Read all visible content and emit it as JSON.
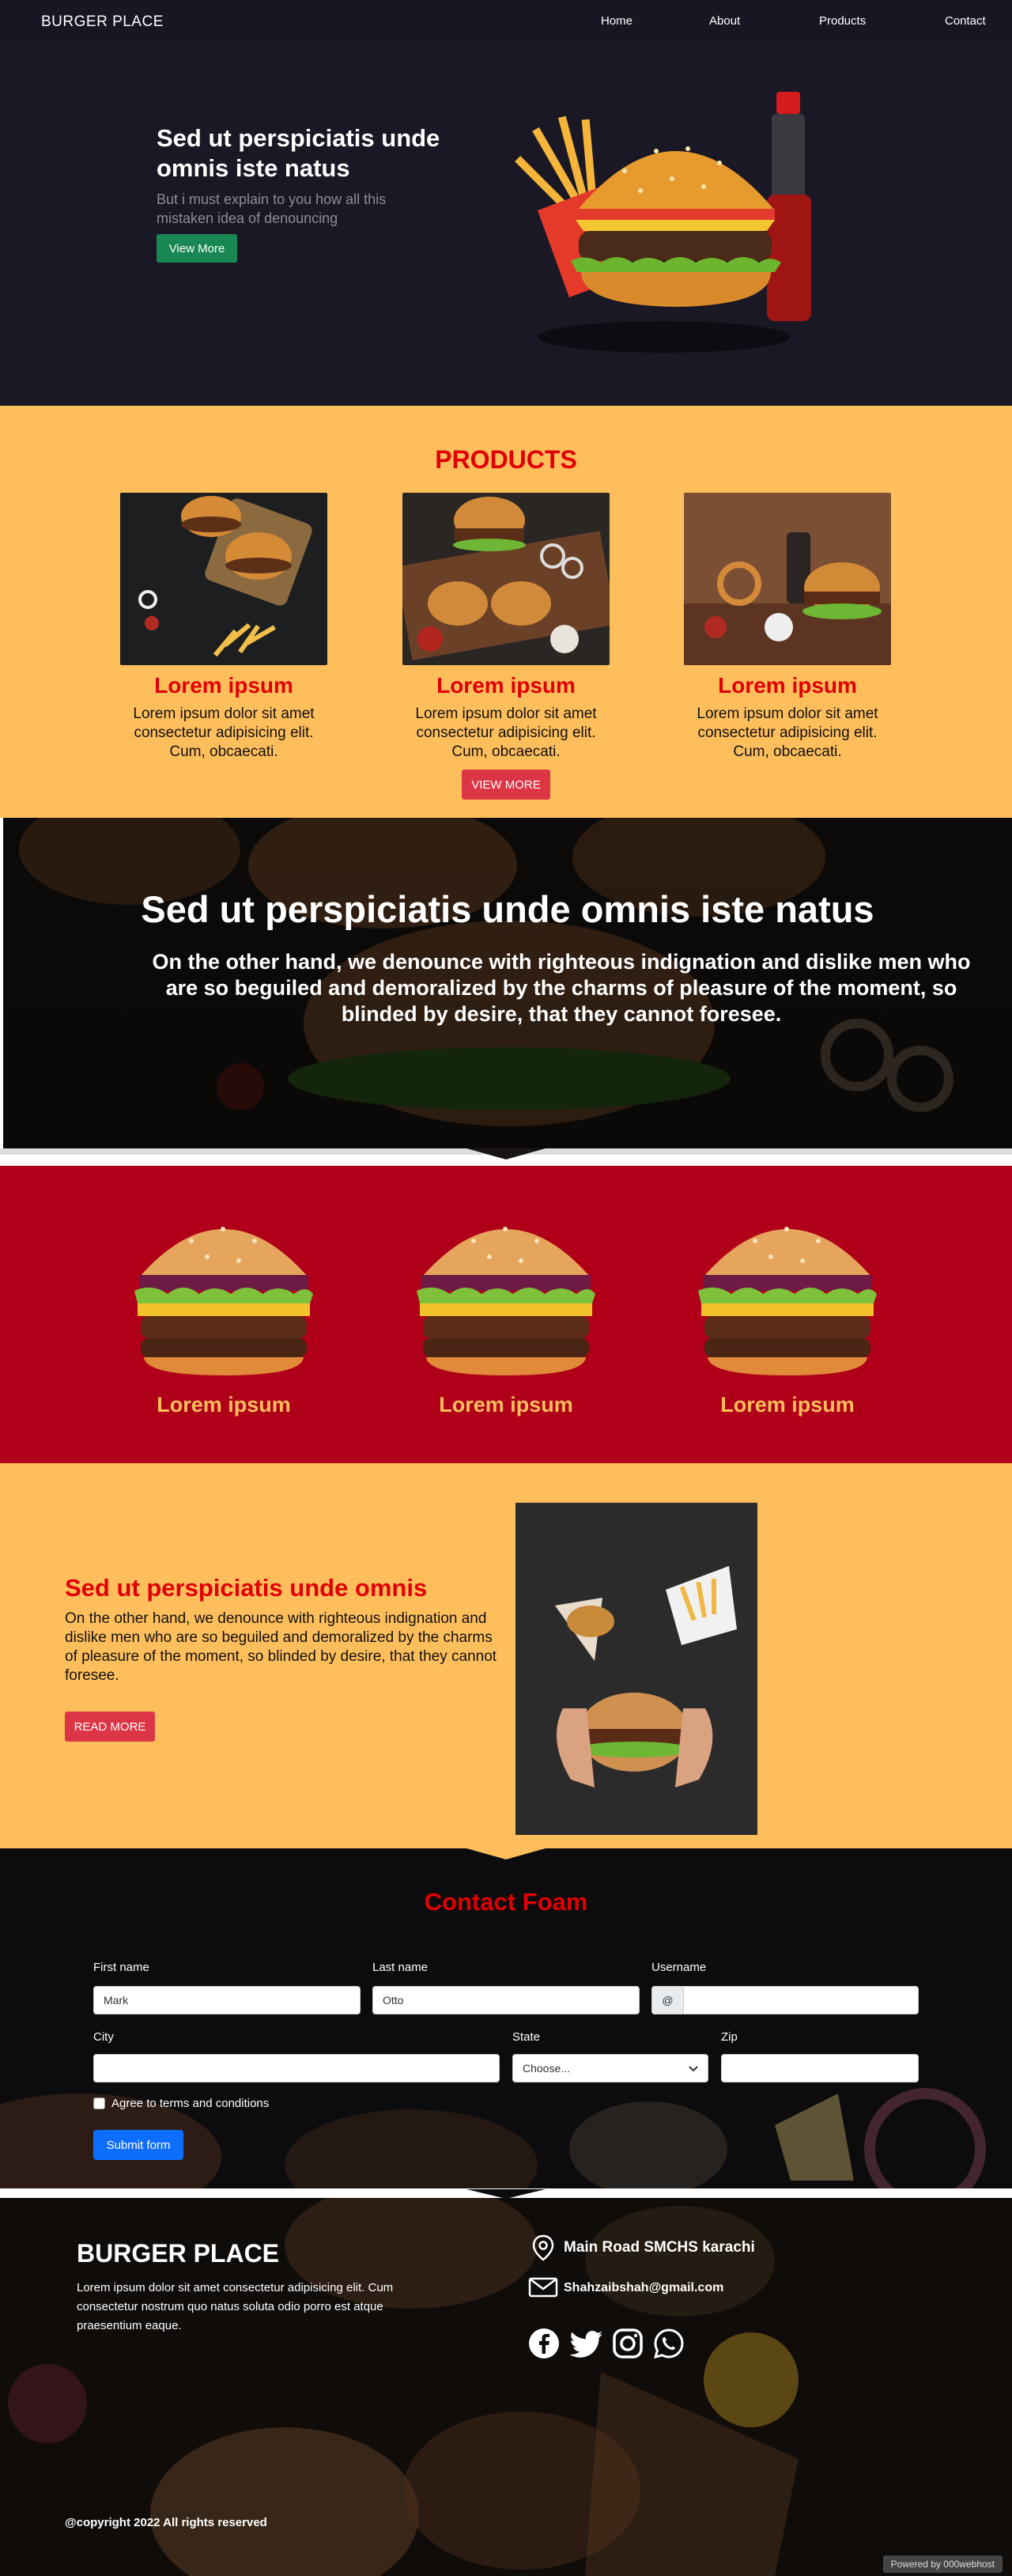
{
  "nav": {
    "brand": "BURGER PLACE",
    "links": [
      "Home",
      "About",
      "Products",
      "Contact"
    ]
  },
  "hero": {
    "title": "Sed ut perspiciatis unde omnis iste natus",
    "subtitle": "But i must explain to you how all this mistaken idea of denouncing",
    "button": "View More"
  },
  "products": {
    "heading": "PRODUCTS",
    "items": [
      {
        "title": "Lorem ipsum",
        "text": "Lorem ipsum dolor sit amet consectetur adipisicing elit. Cum, obcaecati."
      },
      {
        "title": "Lorem ipsum",
        "text": "Lorem ipsum dolor sit amet consectetur adipisicing elit. Cum, obcaecati."
      },
      {
        "title": "Lorem ipsum",
        "text": "Lorem ipsum dolor sit amet consectetur adipisicing elit. Cum, obcaecati."
      }
    ],
    "button": "VIEW MORE"
  },
  "banner": {
    "title": "Sed ut perspiciatis unde omnis iste natus",
    "text": "On the other hand, we denounce with righteous indignation and dislike men who are so beguiled and demoralized by the charms of pleasure of the moment, so blinded by desire, that they cannot foresee."
  },
  "burgers": {
    "items": [
      "Lorem ipsum",
      "Lorem ipsum",
      "Lorem ipsum"
    ]
  },
  "about": {
    "title": "Sed ut perspiciatis unde omnis",
    "text": "On the other hand, we denounce with righteous indignation and dislike men who are so beguiled and demoralized by the charms of pleasure of the moment, so blinded by desire, that they cannot foresee.",
    "button": "READ MORE"
  },
  "contact": {
    "heading": "Contact Foam",
    "first_name_label": "First name",
    "first_name_value": "Mark",
    "last_name_label": "Last name",
    "last_name_value": "Otto",
    "username_label": "Username",
    "username_prefix": "@",
    "city_label": "City",
    "state_label": "State",
    "state_value": "Choose...",
    "zip_label": "Zip",
    "terms_label": "Agree to terms and conditions",
    "submit": "Submit form"
  },
  "footer": {
    "brand": "BURGER PLACE",
    "desc": "Lorem ipsum dolor sit amet consectetur adipisicing elit. Cum consectetur nostrum quo natus soluta odio porro est atque praesentium eaque.",
    "address": "Main Road SMCHS karachi",
    "email": "Shahzaibshah@gmail.com",
    "social_icons": [
      "facebook-icon",
      "twitter-icon",
      "instagram-icon",
      "whatsapp-icon"
    ],
    "copyright": "@copyright 2022 All rights reserved",
    "powered": "Powered by 000webhost"
  },
  "colors": {
    "nav_bg": "#181623",
    "accent_yellow": "#ffbe5c",
    "accent_red": "#e00000",
    "section_red": "#b00019",
    "button_green": "#198754",
    "button_red": "#dc3545",
    "button_blue": "#0d6efd"
  }
}
